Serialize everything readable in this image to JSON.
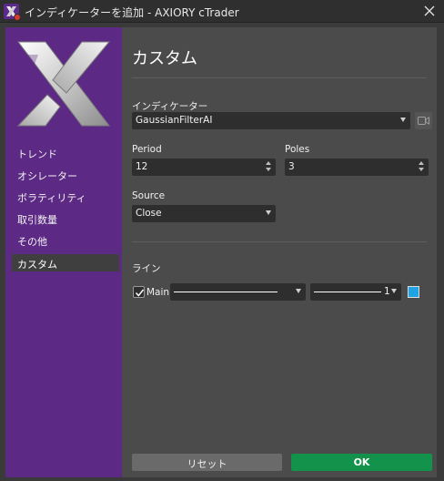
{
  "window": {
    "title": "インディケーターを追加 - AXIORY cTrader"
  },
  "sidebar": {
    "items": [
      {
        "label": "トレンド"
      },
      {
        "label": "オシレーター"
      },
      {
        "label": "ボラティリティ"
      },
      {
        "label": "取引数量"
      },
      {
        "label": "その他"
      },
      {
        "label": "カスタム",
        "selected": true
      }
    ]
  },
  "main": {
    "title": "カスタム",
    "indicator": {
      "label": "インディケーター",
      "value": "GaussianFilterAI"
    },
    "period": {
      "label": "Period",
      "value": "12"
    },
    "poles": {
      "label": "Poles",
      "value": "3"
    },
    "source": {
      "label": "Source",
      "value": "Close"
    },
    "lines": {
      "label": "ライン",
      "main": {
        "checked": true,
        "label": "Main",
        "thickness": "1",
        "color": "#1fa3e3"
      }
    }
  },
  "footer": {
    "reset_label": "リセット",
    "ok_label": "OK"
  },
  "colors": {
    "sidebar": "#5c2a85",
    "ok_button": "#12924a",
    "series_color": "#1fa3e3"
  }
}
